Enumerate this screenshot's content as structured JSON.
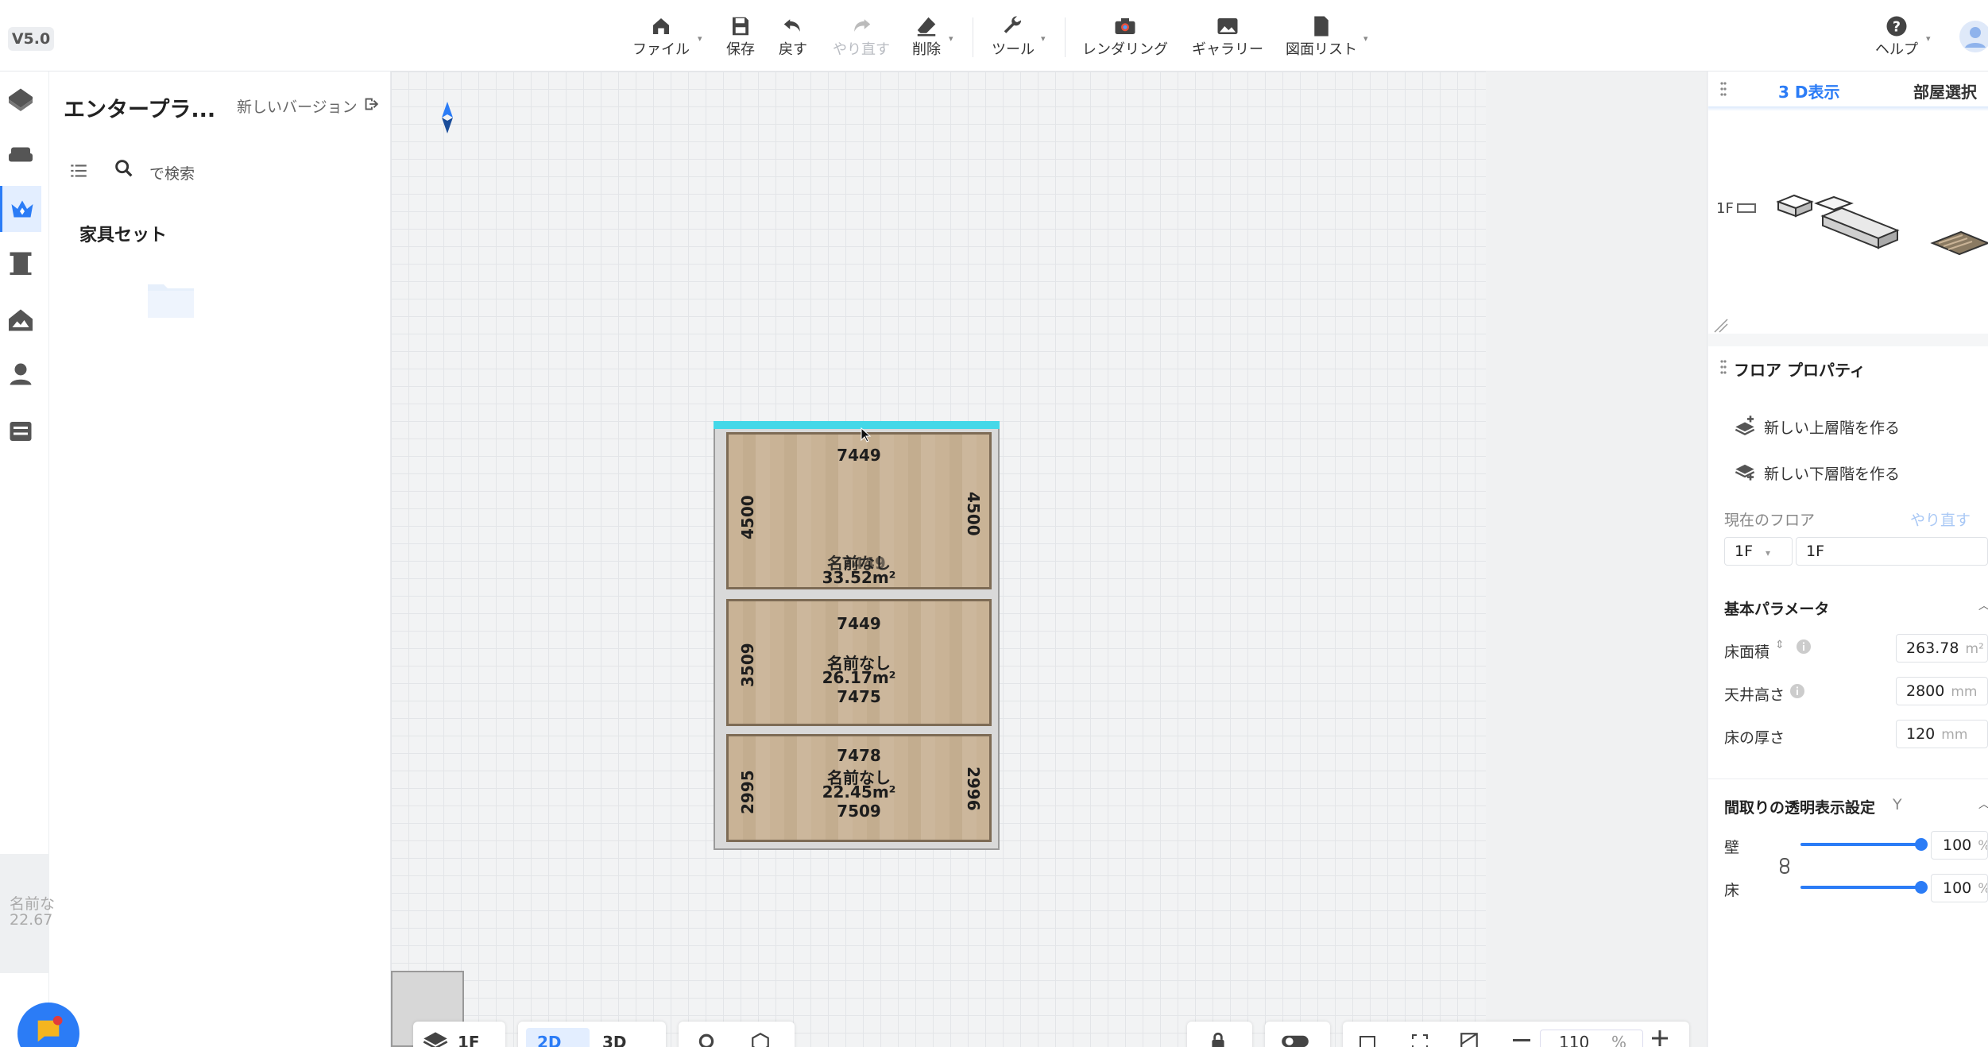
{
  "app": {
    "version": "V5.0"
  },
  "toolbar": {
    "file": "ファイル",
    "save": "保存",
    "undo": "戻す",
    "redo": "やり直す",
    "delete": "削除",
    "tools": "ツール",
    "rendering": "レンダリング",
    "gallery": "ギャラリー",
    "drawing_list": "図面リスト",
    "help": "ヘルプ"
  },
  "left_panel": {
    "title": "エンタープラ...",
    "new_version": "新しいバージョン",
    "search_placeholder": "で検索",
    "category": "家具セット"
  },
  "left_rail_icons": [
    "model-icon",
    "sofa-icon",
    "crown-icon",
    "door-icon",
    "landscape-icon",
    "person-icon",
    "cabinet-icon"
  ],
  "bottom_left_thumb": {
    "line1": "名前な",
    "line2": "22.67"
  },
  "floorplan": {
    "rooms": [
      {
        "top": "7449",
        "left": "4500",
        "right": "4500",
        "name": "名前なし",
        "overlap": "7449",
        "area": "33.52m²"
      },
      {
        "top": "7449",
        "left": "3509",
        "name": "名前なし",
        "area": "26.17m²",
        "bottom": "7475"
      },
      {
        "top": "7478",
        "left": "2995",
        "right": "2996",
        "name": "名前なし",
        "area": "22.45m²",
        "bottom": "7509"
      }
    ]
  },
  "bottom_bar": {
    "floor": "1F",
    "view2d": "2D",
    "view3d": "3D",
    "zoom": "110",
    "zoom_unit": "%"
  },
  "right_panel": {
    "tab_3d": "3 D表示",
    "tab_room": "部屋選択",
    "floor_label": "1F",
    "floor_props_title": "フロア プロパティ",
    "add_upper": "新しい上層階を作る",
    "add_lower": "新しい下層階を作る",
    "current_floor": "現在のフロア",
    "redo_link": "やり直す",
    "floor_select": "1F",
    "floor_name": "1F",
    "basic_params": "基本パラメータ",
    "floor_area_label": "床面積",
    "floor_area_value": "263.78",
    "floor_area_unit": "m²",
    "ceiling_label": "天井高さ",
    "ceiling_value": "2800",
    "ceiling_unit": "mm",
    "thickness_label": "床の厚さ",
    "thickness_value": "120",
    "thickness_unit": "mm",
    "transparency_title": "間取りの透明表示設定",
    "transparency_hint": "Y",
    "wall_label": "壁",
    "wall_value": "100",
    "wall_level": 1.0,
    "floor_label2": "床",
    "floor_value": "100",
    "floor_level": 1.0,
    "percent": "%"
  },
  "colors": {
    "accent": "#2b7cf6",
    "selection": "#45d8e8"
  }
}
